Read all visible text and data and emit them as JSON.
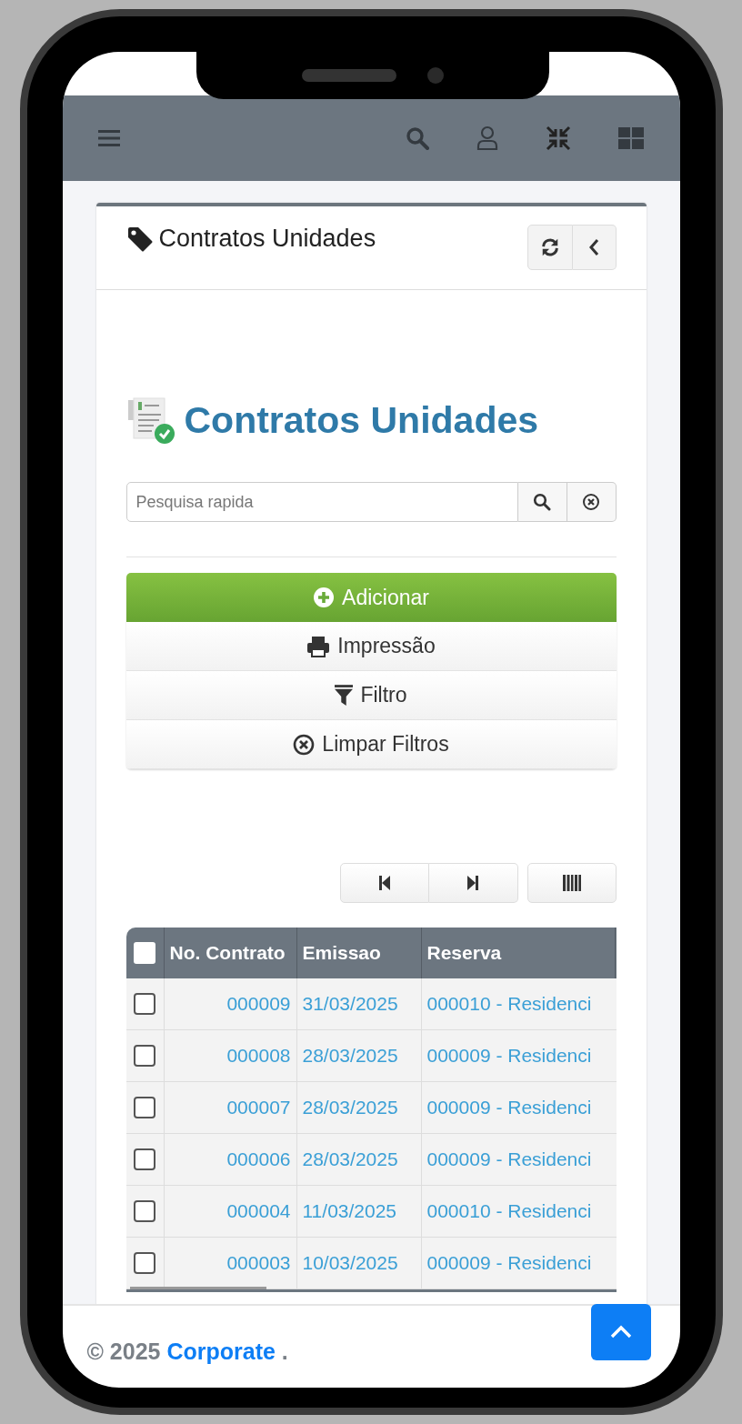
{
  "card": {
    "title": "Contratos Unidades"
  },
  "heading": "Contratos Unidades",
  "search": {
    "placeholder": "Pesquisa rapida"
  },
  "actions": [
    {
      "kind": "add",
      "label": "Adicionar"
    },
    {
      "kind": "print",
      "label": "Impressão"
    },
    {
      "kind": "filter",
      "label": "Filtro"
    },
    {
      "kind": "clear",
      "label": "Limpar Filtros"
    }
  ],
  "table": {
    "select_all_checked": false,
    "columns": [
      "No. Contrato",
      "Emissao",
      "Reserva"
    ],
    "rows": [
      {
        "checked": false,
        "cells": [
          "000009",
          "31/03/2025",
          "000010 - Residenci"
        ]
      },
      {
        "checked": false,
        "cells": [
          "000008",
          "28/03/2025",
          "000009 - Residenci"
        ]
      },
      {
        "checked": false,
        "cells": [
          "000007",
          "28/03/2025",
          "000009 - Residenci"
        ]
      },
      {
        "checked": false,
        "cells": [
          "000006",
          "28/03/2025",
          "000009 - Residenci"
        ]
      },
      {
        "checked": false,
        "cells": [
          "000004",
          "11/03/2025",
          "000010 - Residenci"
        ]
      },
      {
        "checked": false,
        "cells": [
          "000003",
          "10/03/2025",
          "000009 - Residenci"
        ]
      }
    ]
  },
  "footer": {
    "copyright": "© 2025",
    "link": "Corporate",
    "suffix": "."
  }
}
